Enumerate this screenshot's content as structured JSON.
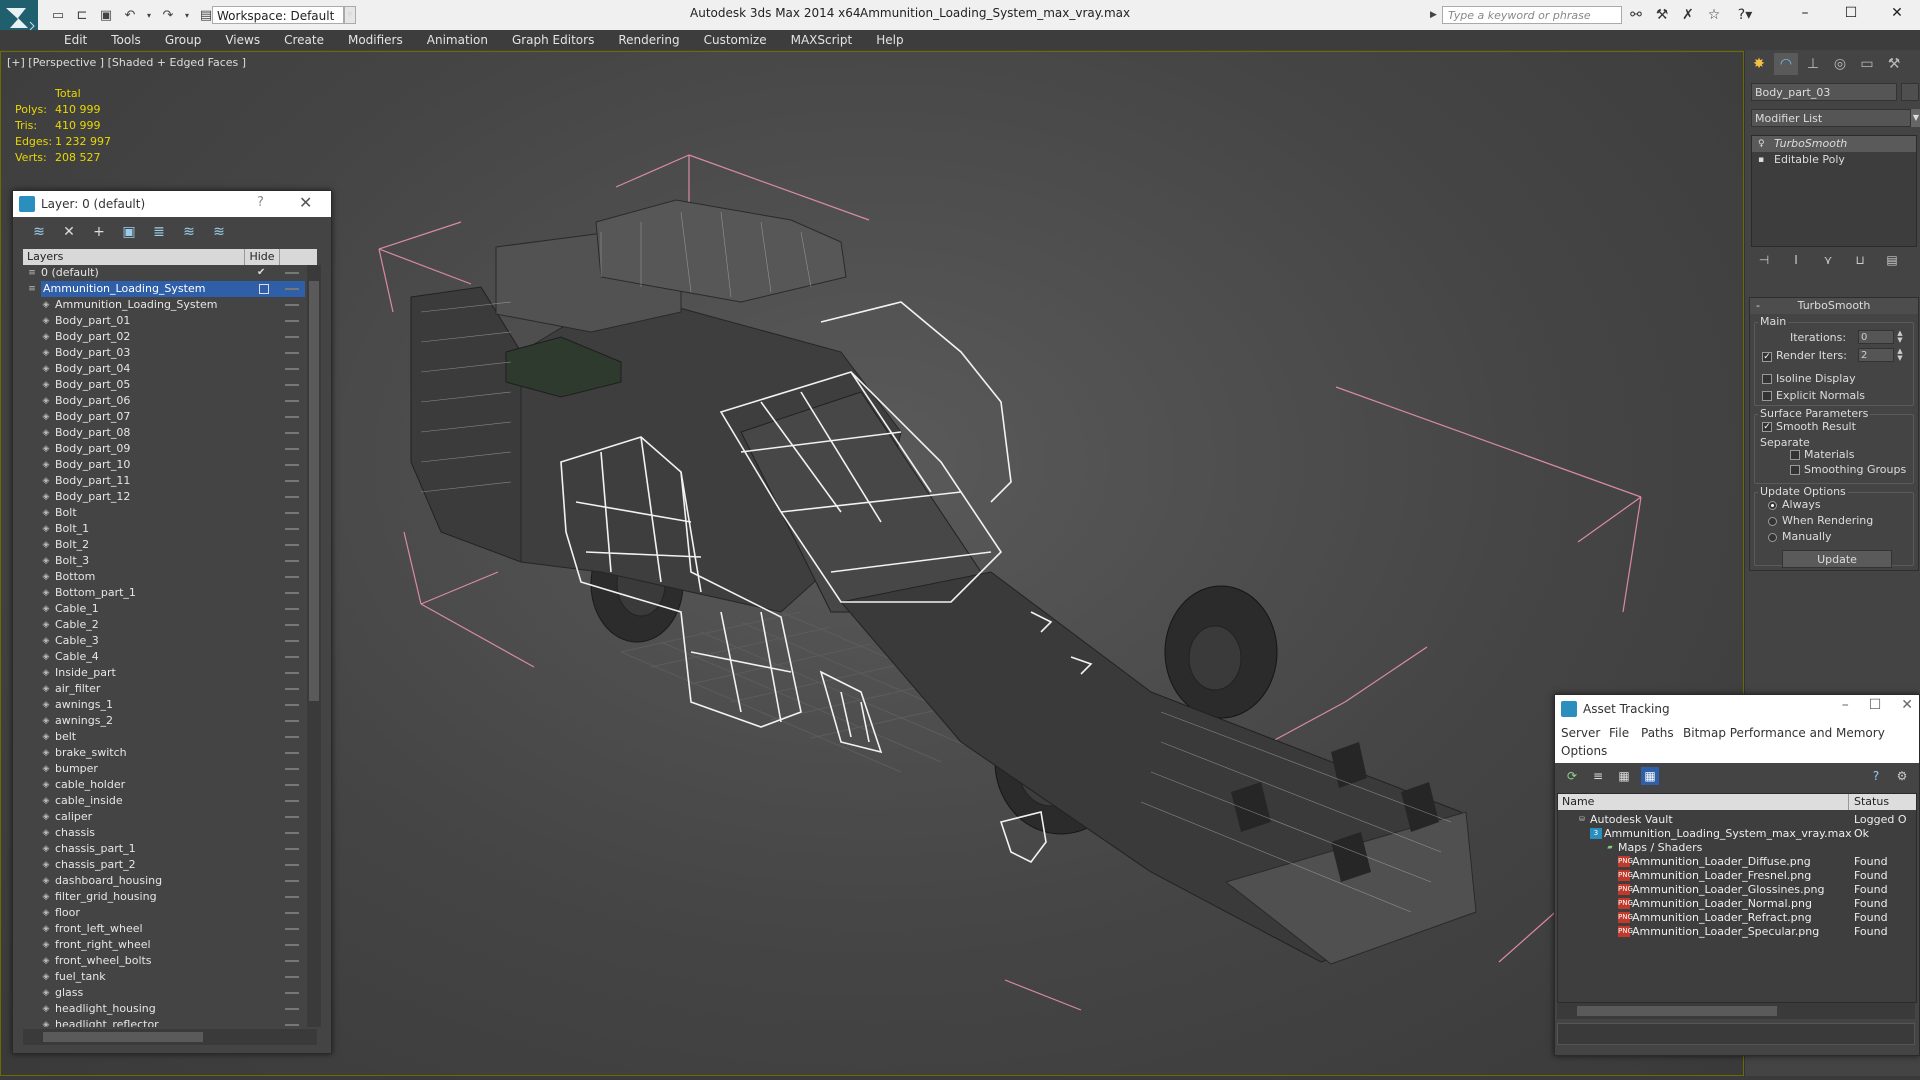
{
  "title_bar": {
    "app_title": "Autodesk 3ds Max  2014 x64",
    "file_title": "Ammunition_Loading_System_max_vray.max",
    "workspace": "Workspace: Default",
    "search_placeholder": "Type a keyword or phrase",
    "window_controls": [
      "–",
      "☐",
      "✕"
    ]
  },
  "menu": [
    "Edit",
    "Tools",
    "Group",
    "Views",
    "Create",
    "Modifiers",
    "Animation",
    "Graph Editors",
    "Rendering",
    "Customize",
    "MAXScript",
    "Help"
  ],
  "viewport": {
    "label": "[+] [Perspective ] [Shaded + Edged Faces ]",
    "stats": {
      "header": "Total",
      "rows": [
        {
          "key": "Polys:",
          "value": "410 999"
        },
        {
          "key": "Tris:",
          "value": "410 999"
        },
        {
          "key": "Edges:",
          "value": "1 232 997"
        },
        {
          "key": "Verts:",
          "value": "208 527"
        }
      ]
    }
  },
  "layer_dialog": {
    "title": "Layer: 0 (default)",
    "help": "?",
    "columns": {
      "layers": "Layers",
      "hide": "Hide"
    },
    "rows": [
      {
        "name": "0 (default)",
        "level": 1,
        "type": "layer",
        "check": "✔"
      },
      {
        "name": "Ammunition_Loading_System",
        "level": 1,
        "type": "layer",
        "selected": true
      },
      {
        "name": "Ammunition_Loading_System",
        "level": 2
      },
      {
        "name": "Body_part_01",
        "level": 2
      },
      {
        "name": "Body_part_02",
        "level": 2
      },
      {
        "name": "Body_part_03",
        "level": 2
      },
      {
        "name": "Body_part_04",
        "level": 2
      },
      {
        "name": "Body_part_05",
        "level": 2
      },
      {
        "name": "Body_part_06",
        "level": 2
      },
      {
        "name": "Body_part_07",
        "level": 2
      },
      {
        "name": "Body_part_08",
        "level": 2
      },
      {
        "name": "Body_part_09",
        "level": 2
      },
      {
        "name": "Body_part_10",
        "level": 2
      },
      {
        "name": "Body_part_11",
        "level": 2
      },
      {
        "name": "Body_part_12",
        "level": 2
      },
      {
        "name": "Bolt",
        "level": 2
      },
      {
        "name": "Bolt_1",
        "level": 2
      },
      {
        "name": "Bolt_2",
        "level": 2
      },
      {
        "name": "Bolt_3",
        "level": 2
      },
      {
        "name": "Bottom",
        "level": 2
      },
      {
        "name": "Bottom_part_1",
        "level": 2
      },
      {
        "name": "Cable_1",
        "level": 2
      },
      {
        "name": "Cable_2",
        "level": 2
      },
      {
        "name": "Cable_3",
        "level": 2
      },
      {
        "name": "Cable_4",
        "level": 2
      },
      {
        "name": "Inside_part",
        "level": 2
      },
      {
        "name": "air_filter",
        "level": 2
      },
      {
        "name": "awnings_1",
        "level": 2
      },
      {
        "name": "awnings_2",
        "level": 2
      },
      {
        "name": "belt",
        "level": 2
      },
      {
        "name": "brake_switch",
        "level": 2
      },
      {
        "name": "bumper",
        "level": 2
      },
      {
        "name": "cable_holder",
        "level": 2
      },
      {
        "name": "cable_inside",
        "level": 2
      },
      {
        "name": "caliper",
        "level": 2
      },
      {
        "name": "chassis",
        "level": 2
      },
      {
        "name": "chassis_part_1",
        "level": 2
      },
      {
        "name": "chassis_part_2",
        "level": 2
      },
      {
        "name": "dashboard_housing",
        "level": 2
      },
      {
        "name": "filter_grid_housing",
        "level": 2
      },
      {
        "name": "floor",
        "level": 2
      },
      {
        "name": "front_left_wheel",
        "level": 2
      },
      {
        "name": "front_right_wheel",
        "level": 2
      },
      {
        "name": "front_wheel_bolts",
        "level": 2
      },
      {
        "name": "fuel_tank",
        "level": 2
      },
      {
        "name": "glass",
        "level": 2
      },
      {
        "name": "headlight_housing",
        "level": 2
      },
      {
        "name": "headlight_reflector",
        "level": 2
      }
    ]
  },
  "command_panel": {
    "object_name": "Body_part_03",
    "modifier_list": "Modifier List",
    "stack": [
      {
        "label": "TurboSmooth",
        "selected": true
      },
      {
        "label": "Editable Poly",
        "selected": false
      }
    ],
    "turbosmooth": {
      "title": "TurboSmooth",
      "main_label": "Main",
      "iterations_label": "Iterations:",
      "iterations_value": "0",
      "render_iters_label": "Render Iters:",
      "render_iters_value": "2",
      "render_iters_checked": true,
      "isoline_label": "Isoline Display",
      "explicit_normals_label": "Explicit Normals",
      "surface_params_label": "Surface Parameters",
      "smooth_result_label": "Smooth Result",
      "separate_label": "Separate",
      "materials_label": "Materials",
      "smoothing_groups_label": "Smoothing Groups",
      "update_options_label": "Update Options",
      "always_label": "Always",
      "when_rendering_label": "When Rendering",
      "manually_label": "Manually",
      "update_button": "Update"
    }
  },
  "asset_tracking": {
    "title": "Asset Tracking",
    "menu": [
      "Server",
      "File",
      "Paths",
      "Bitmap Performance and Memory",
      "Options"
    ],
    "columns": {
      "name": "Name",
      "status": "Status"
    },
    "rows": [
      {
        "name": "Autodesk Vault",
        "status": "Logged O",
        "indent": 1,
        "icon": "vault"
      },
      {
        "name": "Ammunition_Loading_System_max_vray.max",
        "status": "Ok",
        "indent": 2,
        "icon": "max"
      },
      {
        "name": "Maps / Shaders",
        "status": "",
        "indent": 3,
        "icon": "folder"
      },
      {
        "name": "Ammunition_Loader_Diffuse.png",
        "status": "Found",
        "indent": 4,
        "icon": "png"
      },
      {
        "name": "Ammunition_Loader_Fresnel.png",
        "status": "Found",
        "indent": 4,
        "icon": "png"
      },
      {
        "name": "Ammunition_Loader_Glossines.png",
        "status": "Found",
        "indent": 4,
        "icon": "png"
      },
      {
        "name": "Ammunition_Loader_Normal.png",
        "status": "Found",
        "indent": 4,
        "icon": "png"
      },
      {
        "name": "Ammunition_Loader_Refract.png",
        "status": "Found",
        "indent": 4,
        "icon": "png"
      },
      {
        "name": "Ammunition_Loader_Specular.png",
        "status": "Found",
        "indent": 4,
        "icon": "png"
      }
    ]
  },
  "colors": {
    "stats_yellow": "#e8d800",
    "selection_blue": "#2f5fa8",
    "bbox_pink": "#d98aa6"
  }
}
